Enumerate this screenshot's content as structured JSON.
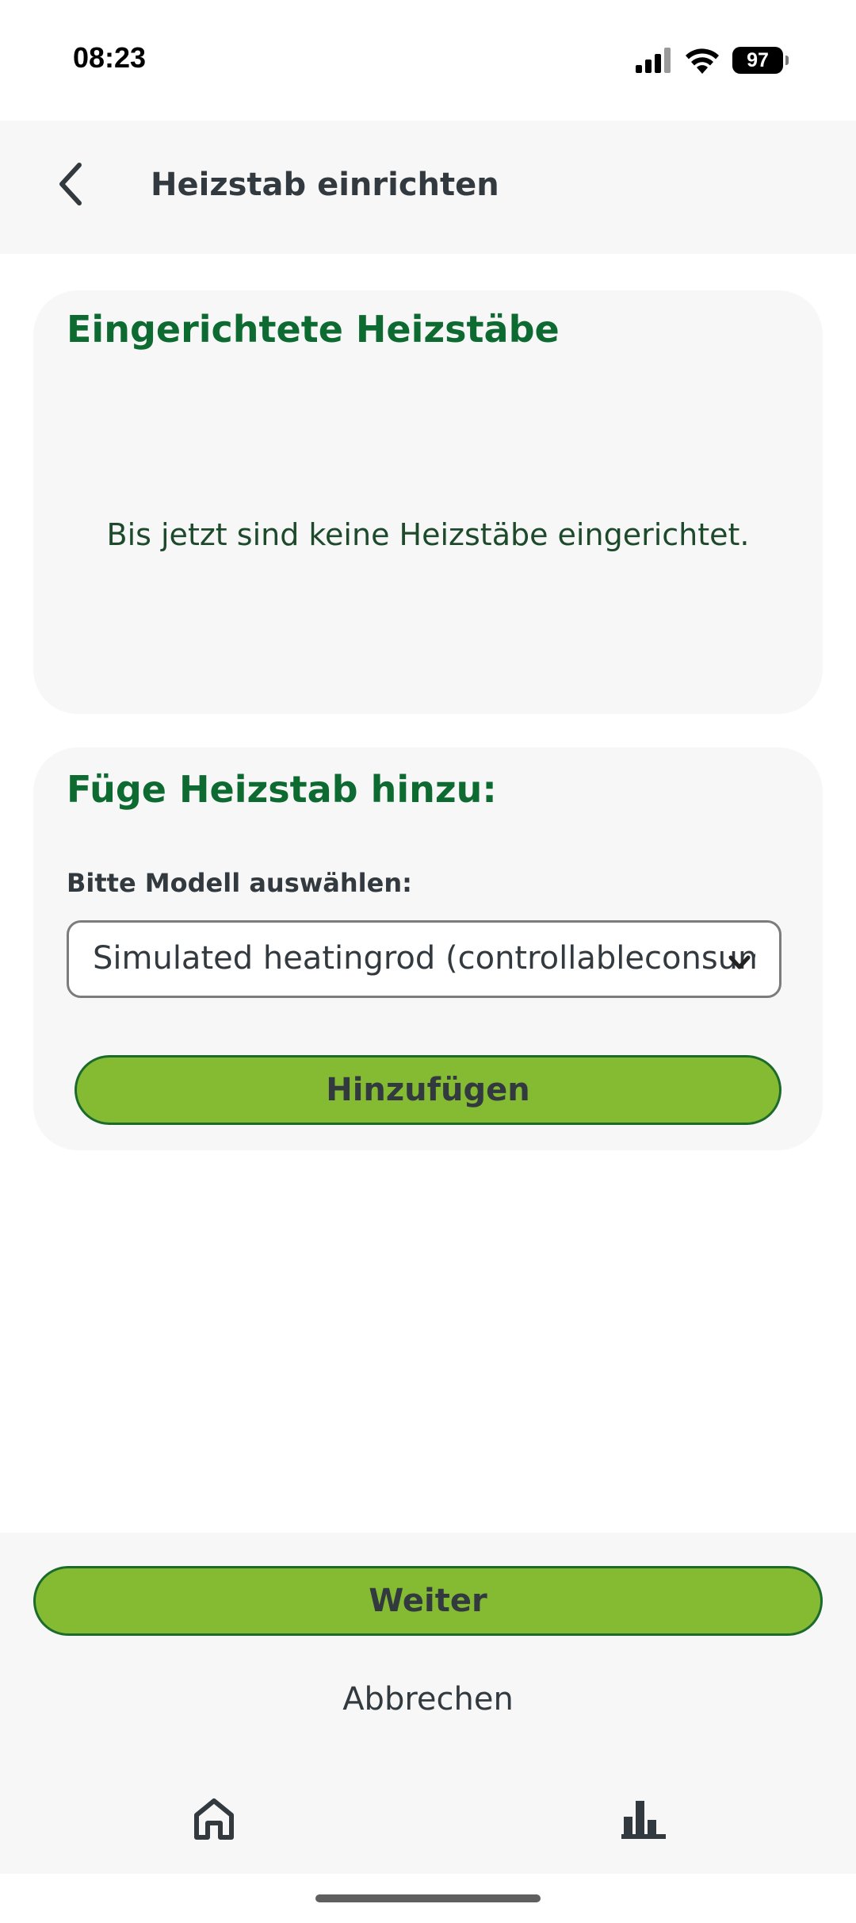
{
  "status_bar": {
    "time": "08:23",
    "battery": "97",
    "icons": [
      "signal-icon",
      "wifi-icon",
      "battery-icon"
    ]
  },
  "header": {
    "title": "Heizstab einrichten",
    "back_icon": "chevron-left-icon"
  },
  "installed_section": {
    "title": "Eingerichtete Heizstäbe",
    "empty_message": "Bis jetzt sind keine Heizstäbe eingerichtet."
  },
  "add_section": {
    "title": "Füge Heizstab hinzu:",
    "model_label": "Bitte Modell auswählen:",
    "selected_model": "Simulated heatingrod (controllableconsumer)",
    "add_button": "Hinzufügen"
  },
  "footer": {
    "next_button": "Weiter",
    "cancel_button": "Abbrechen"
  },
  "bottom_nav": {
    "items": [
      "home-icon",
      "bar-chart-icon"
    ]
  },
  "colors": {
    "accent_green": "#84bb33",
    "title_green": "#0d6b32",
    "border_green": "#1d6b2c",
    "text_dark": "#333a3f",
    "surface": "#f7f7f7"
  }
}
